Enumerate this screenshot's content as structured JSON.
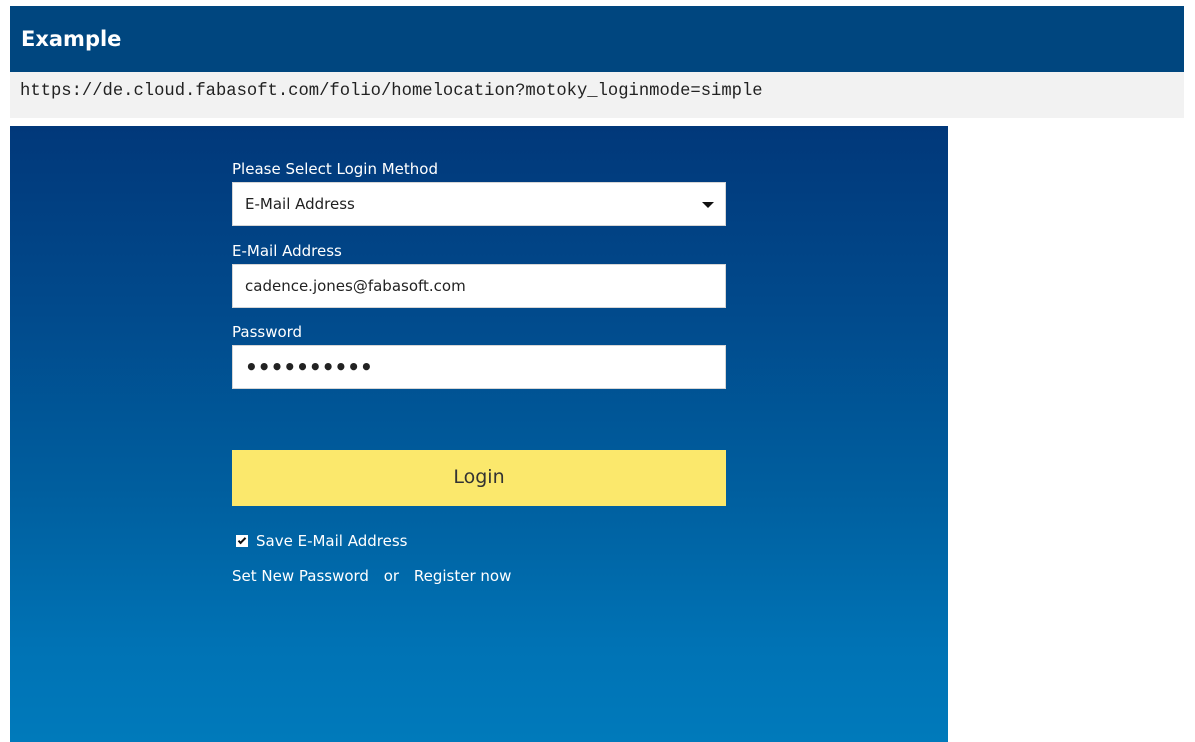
{
  "header": {
    "title": "Example"
  },
  "url_bar": {
    "url": "https://de.cloud.fabasoft.com/folio/homelocation?motoky_loginmode=simple"
  },
  "login_form": {
    "method_label": "Please Select Login Method",
    "method_value": "E-Mail Address",
    "email_label": "E-Mail Address",
    "email_value": "cadence.jones@fabasoft.com",
    "password_label": "Password",
    "password_value": "••••••••••",
    "login_button_label": "Login",
    "save_email_label": "Save E-Mail Address",
    "save_email_checked": true,
    "set_new_password_link": "Set New Password",
    "or_text": "or",
    "register_link": "Register now"
  },
  "colors": {
    "header_background": "#00467f",
    "panel_gradient_top": "#01387a",
    "panel_gradient_bottom": "#007abb",
    "login_button": "#fbe86c",
    "url_bar_background": "#f2f2f2"
  },
  "icons": {
    "dropdown": "caret-down-icon",
    "checkbox": "checkmark-icon"
  }
}
